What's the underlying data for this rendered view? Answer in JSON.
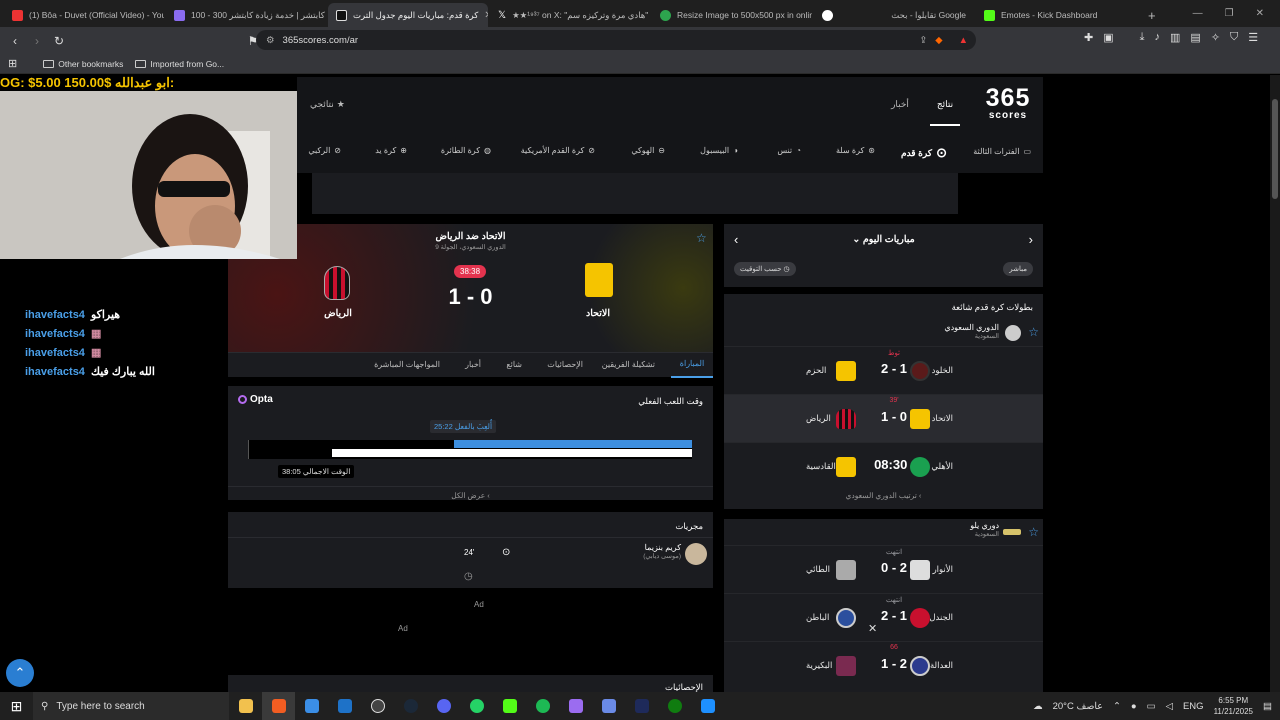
{
  "browser": {
    "tabs": [
      {
        "label": "(1) Bôa - Duvet (Official Video) - You",
        "color": "#e33"
      },
      {
        "label": "100 - 300 كابتشر | خدمة زيادة كابتشر",
        "color": "#8a6cf0"
      },
      {
        "label": "كرة قدم: مباريات اليوم جدول الترت",
        "color": "#ddd"
      },
      {
        "label": "★★¹⁹³⁷ on X: \"هادي مرة وتركيزه سم\"",
        "color": "#fff"
      },
      {
        "label": "Resize Image to 500x500 px in onlin",
        "color": "#2da44e"
      },
      {
        "label": "تقابلوا - بحث Google",
        "color": "#fff"
      },
      {
        "label": "Emotes - Kick Dashboard",
        "color": "#53fc18"
      }
    ],
    "url": "365scores.com/ar",
    "bookmarks": [
      "Other bookmarks",
      "Imported from Go..."
    ]
  },
  "stream": {
    "donation": "OG: $5.00    150.00$ ابو عبدالله:",
    "chat": [
      {
        "user": "ihavefacts4",
        "msg": "هيراكو"
      },
      {
        "user": "ihavefacts4",
        "msg": "▦"
      },
      {
        "user": "ihavefacts4",
        "msg": "▦"
      },
      {
        "user": "ihavefacts4",
        "msg": "الله يبارك فيك"
      }
    ]
  },
  "site": {
    "logo_top": "365",
    "logo_bottom": "scores",
    "nav": [
      "نتائج",
      "أخبار",
      "نتائجي"
    ],
    "sports": [
      "الفترات الثالثة",
      "كرة قدم",
      "كرة سلة",
      "تنس",
      "البيسبول",
      "الهوكي",
      "كرة القدم الأمريكية",
      "كرة الطائرة",
      "كرة يد",
      "الركبي"
    ]
  },
  "match": {
    "title": "الاتحاد ضد الرياض",
    "subtitle": "الدوري السعودي، الجولة 9",
    "home": "الاتحاد",
    "away": "الرياض",
    "score": "1 - 0",
    "minute": "38:38",
    "tabs": [
      "المباراة",
      "تشكيلة الفريقين",
      "الإحصائيات",
      "شائع",
      "أخبار",
      "المواجهات المباشرة"
    ],
    "playtime_title": "وقت اللعب الفعلي",
    "opta": "Opta",
    "actual_label": "أُلعِبَ بالفعل 25:22",
    "total_label": "الوقت الاجمالي 38:05",
    "actual_fraction": 0.66,
    "show_all": "عرض الكل",
    "events_title": "مجريات",
    "event_player": "كريم بنزيما",
    "event_assist": "(موسى ديابي)",
    "event_minute": "24'",
    "ad1": "Ad",
    "ad2": "Ad",
    "stats_title": "الإحصائيات"
  },
  "sidebar": {
    "title": "مباريات اليوم",
    "live_chip": "مباشر",
    "time_chip": "حسب التوقيت",
    "section": "بطولات كرة قدم شائعة",
    "league1": {
      "name": "الدوري السعودي",
      "country": "السعودية"
    },
    "matches1": [
      {
        "home": "الخلود",
        "away": "الحزم",
        "score": "2 - 1",
        "status": "ثوط"
      },
      {
        "home": "الاتحاد",
        "away": "الرياض",
        "score": "1 - 0",
        "status": "39'"
      },
      {
        "home": "الأهلي",
        "away": "القادسية",
        "score": "08:30",
        "status": "م"
      }
    ],
    "standings": "ترتيب الدوري السعودي",
    "league2": {
      "name": "دوري يلو",
      "country": "السعودية"
    },
    "matches2": [
      {
        "home": "الأنوار",
        "away": "الطائي",
        "score": "0 - 2",
        "status": "انتهت"
      },
      {
        "home": "الجندل",
        "away": "الباطن",
        "score": "2 - 1",
        "status": "انتهت"
      },
      {
        "home": "العدالة",
        "away": "البكيرية",
        "score": "1 - 2",
        "status": "66"
      }
    ]
  },
  "taskbar": {
    "search": "Type here to search",
    "weather": "20°C  عاصف",
    "lang": "ENG",
    "time": "6:55 PM",
    "date": "11/21/2025"
  }
}
